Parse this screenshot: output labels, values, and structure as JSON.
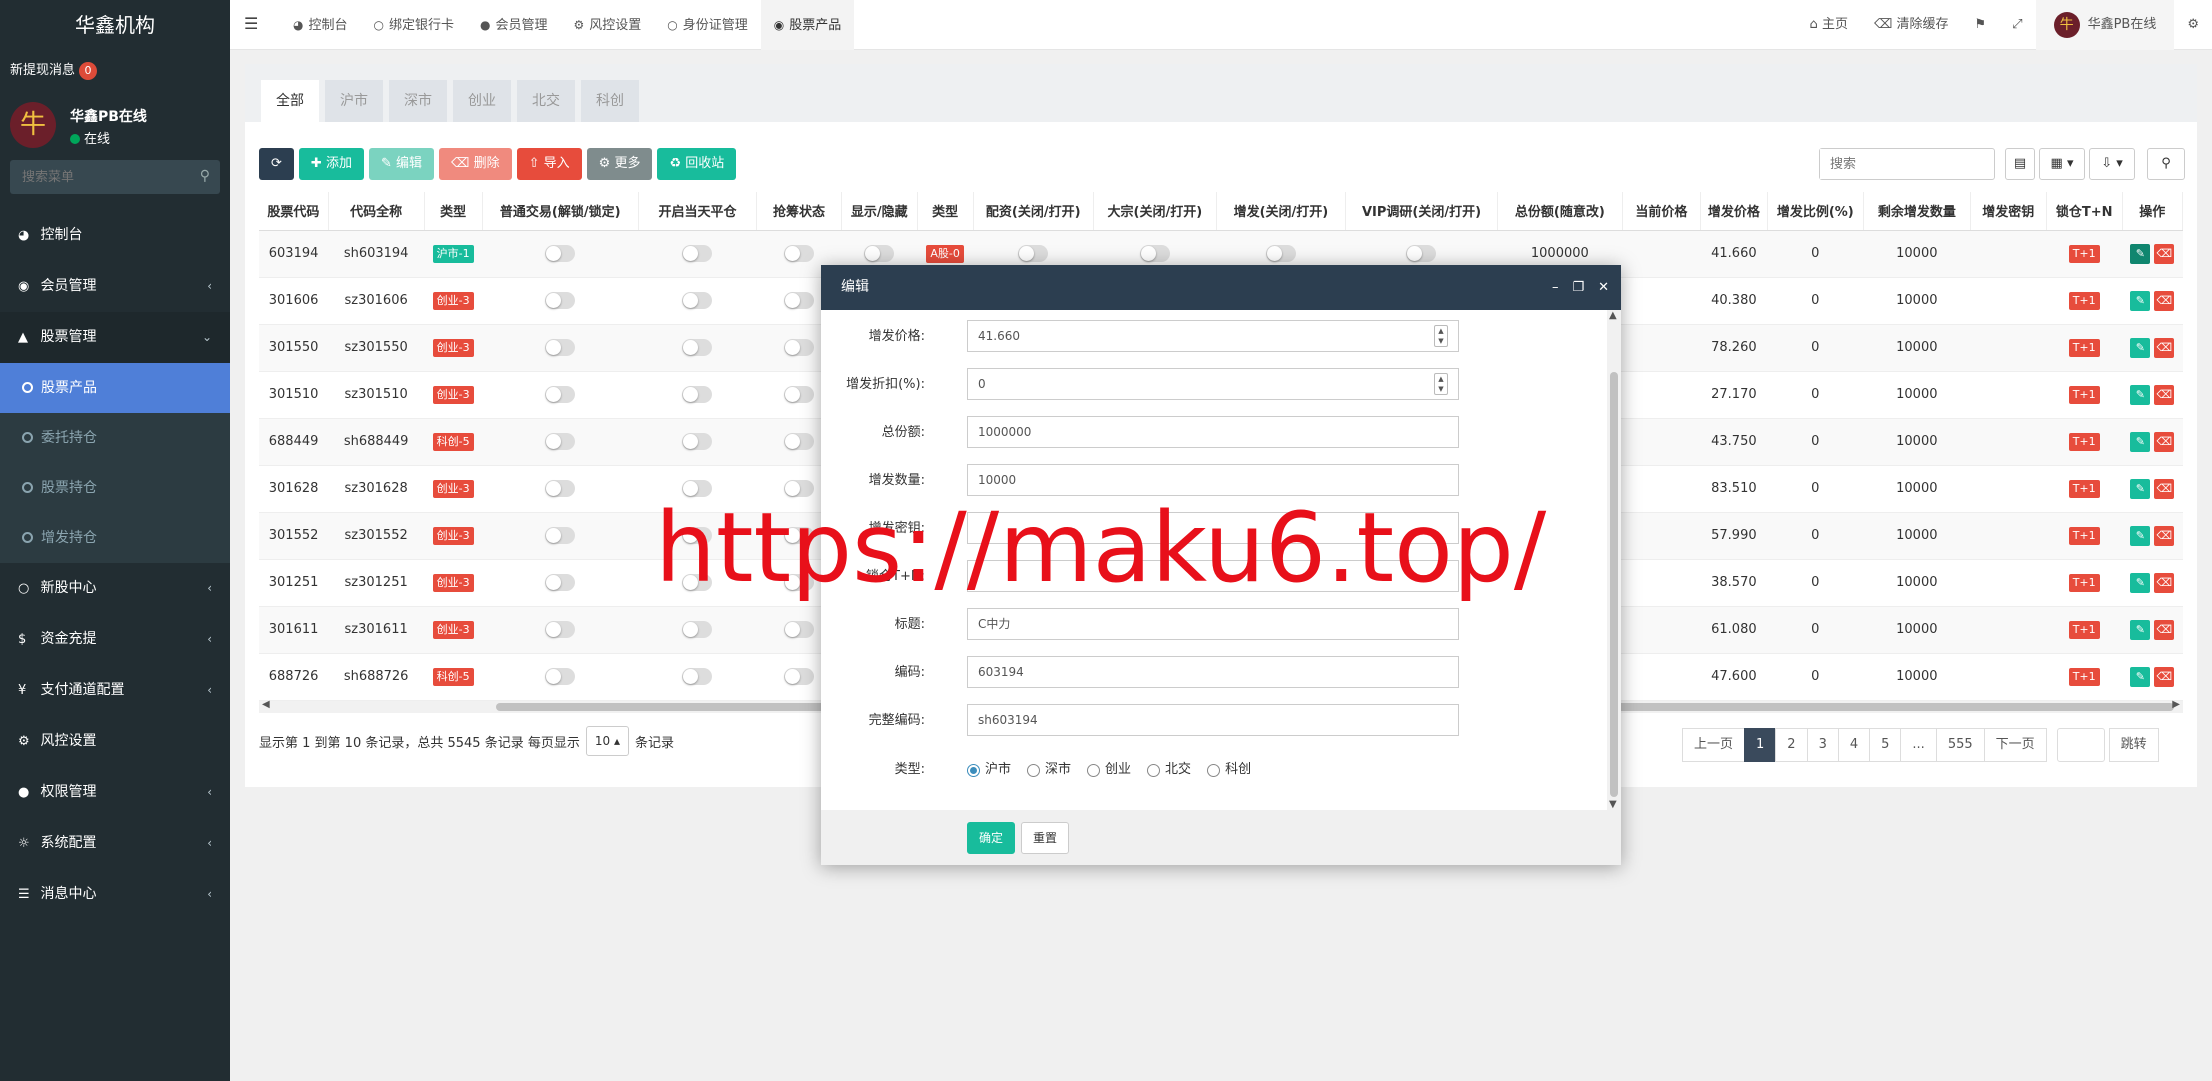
{
  "sidebar": {
    "brand": "华鑫机构",
    "notice_label": "新提现消息",
    "notice_count": "0",
    "avatar_char": "牛",
    "user_name": "华鑫PB在线",
    "user_status": "在线",
    "search_placeholder": "搜索菜单",
    "menu": [
      {
        "label": "控制台",
        "icon": "dashboard-icon"
      },
      {
        "label": "会员管理",
        "icon": "user-circle-icon"
      },
      {
        "label": "股票管理",
        "icon": "bank-icon"
      },
      {
        "label": "新股中心",
        "icon": "circle-icon"
      },
      {
        "label": "资金充提",
        "icon": "dollar-icon"
      },
      {
        "label": "支付通道配置",
        "icon": "yen-icon"
      },
      {
        "label": "风控设置",
        "icon": "gear-icon"
      },
      {
        "label": "权限管理",
        "icon": "group-icon"
      },
      {
        "label": "系统配置",
        "icon": "cog-icon"
      },
      {
        "label": "消息中心",
        "icon": "list-icon"
      }
    ],
    "submenu": [
      "股票产品",
      "委托持仓",
      "股票持仓",
      "增发持仓"
    ]
  },
  "topbar": {
    "tabs": [
      "控制台",
      "绑定银行卡",
      "会员管理",
      "风控设置",
      "身份证管理",
      "股票产品"
    ],
    "home": "主页",
    "clear_cache": "清除缓存",
    "user": "华鑫PB在线"
  },
  "filter_tabs": [
    "全部",
    "沪市",
    "深市",
    "创业",
    "北交",
    "科创"
  ],
  "toolbar": {
    "add": "添加",
    "edit": "编辑",
    "delete": "删除",
    "import": "导入",
    "more": "更多",
    "recycle": "回收站",
    "search_placeholder": "搜索"
  },
  "table": {
    "headers": [
      "股票代码",
      "代码全称",
      "类型",
      "普通交易(解锁/锁定)",
      "开启当天平仓",
      "抢筹状态",
      "显示/隐藏",
      "类型",
      "配资(关闭/打开)",
      "大宗(关闭/打开)",
      "增发(关闭/打开)",
      "VIP调研(关闭/打开)",
      "总份额(随意改)",
      "当前价格",
      "增发价格",
      "增发比例(%)",
      "剩余增发数量",
      "增发密钥",
      "锁仓T+N",
      "操作"
    ],
    "rows": [
      {
        "code": "603194",
        "full": "sh603194",
        "type": "沪市-1",
        "color": "#18bc9c",
        "type2": "A股-0",
        "total": "1000000",
        "price": "41.660",
        "ratio": "0",
        "remain": "10000",
        "lock": "T+1"
      },
      {
        "code": "301606",
        "full": "sz301606",
        "type": "创业-3",
        "color": "#e74c3c",
        "type2": "",
        "total": "",
        "price": "40.380",
        "ratio": "0",
        "remain": "10000",
        "lock": "T+1"
      },
      {
        "code": "301550",
        "full": "sz301550",
        "type": "创业-3",
        "color": "#e74c3c",
        "type2": "",
        "total": "",
        "price": "78.260",
        "ratio": "0",
        "remain": "10000",
        "lock": "T+1"
      },
      {
        "code": "301510",
        "full": "sz301510",
        "type": "创业-3",
        "color": "#e74c3c",
        "type2": "",
        "total": "",
        "price": "27.170",
        "ratio": "0",
        "remain": "10000",
        "lock": "T+1"
      },
      {
        "code": "688449",
        "full": "sh688449",
        "type": "科创-5",
        "color": "#e74c3c",
        "type2": "",
        "total": "",
        "price": "43.750",
        "ratio": "0",
        "remain": "10000",
        "lock": "T+1"
      },
      {
        "code": "301628",
        "full": "sz301628",
        "type": "创业-3",
        "color": "#e74c3c",
        "type2": "",
        "total": "",
        "price": "83.510",
        "ratio": "0",
        "remain": "10000",
        "lock": "T+1"
      },
      {
        "code": "301552",
        "full": "sz301552",
        "type": "创业-3",
        "color": "#e74c3c",
        "type2": "",
        "total": "",
        "price": "57.990",
        "ratio": "0",
        "remain": "10000",
        "lock": "T+1"
      },
      {
        "code": "301251",
        "full": "sz301251",
        "type": "创业-3",
        "color": "#e74c3c",
        "type2": "",
        "total": "",
        "price": "38.570",
        "ratio": "0",
        "remain": "10000",
        "lock": "T+1"
      },
      {
        "code": "301611",
        "full": "sz301611",
        "type": "创业-3",
        "color": "#e74c3c",
        "type2": "",
        "total": "",
        "price": "61.080",
        "ratio": "0",
        "remain": "10000",
        "lock": "T+1"
      },
      {
        "code": "688726",
        "full": "sh688726",
        "type": "科创-5",
        "color": "#e74c3c",
        "type2": "",
        "total": "",
        "price": "47.600",
        "ratio": "0",
        "remain": "10000",
        "lock": "T+1"
      }
    ]
  },
  "pagination": {
    "info_prefix": "显示第 1 到第 10 条记录，总共 5545 条记录 每页显示",
    "page_size": "10",
    "info_suffix": "条记录",
    "prev": "上一页",
    "pages": [
      "1",
      "2",
      "3",
      "4",
      "5",
      "...",
      "555"
    ],
    "next": "下一页",
    "go": "跳转"
  },
  "modal": {
    "title": "编辑",
    "fields": [
      {
        "label": "增发价格:",
        "value": "41.660",
        "spinner": true
      },
      {
        "label": "增发折扣(%):",
        "value": "0",
        "spinner": true
      },
      {
        "label": "总份额:",
        "value": "1000000"
      },
      {
        "label": "增发数量:",
        "value": "10000"
      },
      {
        "label": "增发密钥:",
        "value": ""
      },
      {
        "label": "锁仓T+N:",
        "value": ""
      },
      {
        "label": "标题:",
        "value": "C中力"
      },
      {
        "label": "编码:",
        "value": "603194"
      },
      {
        "label": "完整编码:",
        "value": "sh603194"
      }
    ],
    "type_label": "类型:",
    "type_options": [
      "沪市",
      "深市",
      "创业",
      "北交",
      "科创"
    ],
    "type_selected": "沪市",
    "ok": "确定",
    "reset": "重置"
  },
  "watermark": "https://maku6.top/"
}
